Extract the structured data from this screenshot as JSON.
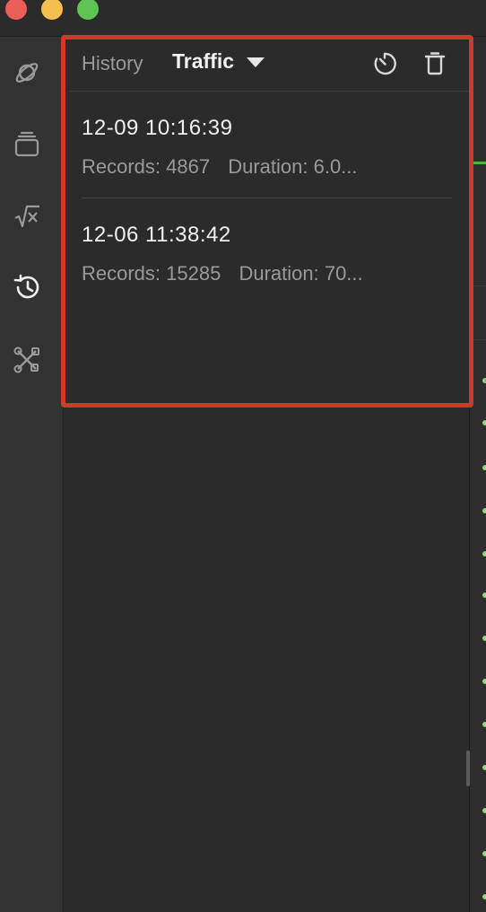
{
  "window": {
    "controls": [
      "close",
      "minimize",
      "zoom"
    ],
    "colors": {
      "close": "#ec5f59",
      "minimize": "#f4bf4f",
      "zoom": "#5fc454"
    }
  },
  "activity_bar": {
    "items": [
      {
        "icon": "planet-icon",
        "active": false
      },
      {
        "icon": "stack-icon",
        "active": false
      },
      {
        "icon": "sqrt-x-icon",
        "active": false
      },
      {
        "icon": "history-icon",
        "active": true
      },
      {
        "icon": "tools-icon",
        "active": false
      }
    ]
  },
  "panel": {
    "title": "History",
    "selector": {
      "selected": "Traffic"
    },
    "actions": [
      {
        "icon": "timer-icon"
      },
      {
        "icon": "trash-icon"
      }
    ],
    "entries": [
      {
        "time": "12-09 10:16:39",
        "records": "Records: 4867",
        "duration": "Duration: 6.0..."
      },
      {
        "time": "12-06 11:38:42",
        "records": "Records: 15285",
        "duration": "Duration: 70..."
      }
    ]
  },
  "colors": {
    "highlight_border": "#d0382a",
    "background": "#2b2b2b",
    "accent_green": "#57b04a"
  }
}
